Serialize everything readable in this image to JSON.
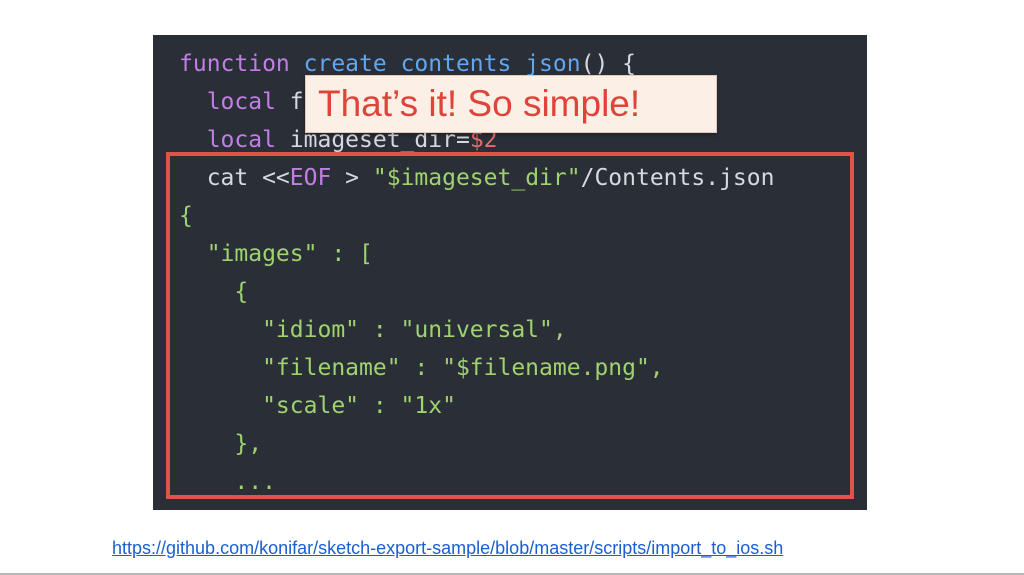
{
  "slide": {
    "callout_text": "That’s it! So simple!",
    "source_link": "https://github.com/konifar/sketch-export-sample/blob/master/scripts/import_to_ios.sh"
  },
  "colors": {
    "background": "#2a2e37",
    "keyword": "#c27ee6",
    "function_name": "#62a6f0",
    "string": "#9fd270",
    "variable": "#e06c6c",
    "highlight_border": "#e0534a",
    "callout_text": "#e0433a",
    "link": "#1a5fd0"
  },
  "code": {
    "lines": [
      [
        {
          "t": "function",
          "k": "kw"
        },
        {
          "t": " ",
          "k": "plain"
        },
        {
          "t": "create_contents_json",
          "k": "fn"
        },
        {
          "t": "() {",
          "k": "plain"
        }
      ],
      [
        {
          "t": "  local",
          "k": "kw"
        },
        {
          "t": " filename=$1",
          "k": "plain"
        }
      ],
      [
        {
          "t": "  local",
          "k": "kw"
        },
        {
          "t": " imageset_dir=",
          "k": "plain"
        },
        {
          "t": "$2",
          "k": "var"
        }
      ],
      [
        {
          "t": "  cat <<",
          "k": "plain"
        },
        {
          "t": "EOF",
          "k": "kw"
        },
        {
          "t": " > ",
          "k": "plain"
        },
        {
          "t": "\"$imageset_dir\"",
          "k": "str"
        },
        {
          "t": "/Contents.json",
          "k": "plain"
        }
      ],
      [
        {
          "t": "{",
          "k": "str"
        }
      ],
      [
        {
          "t": "  \"images\" : [",
          "k": "str"
        }
      ],
      [
        {
          "t": "    {",
          "k": "str"
        }
      ],
      [
        {
          "t": "      \"idiom\" : \"universal\",",
          "k": "str"
        }
      ],
      [
        {
          "t": "      \"filename\" : \"$filename.png\",",
          "k": "str"
        }
      ],
      [
        {
          "t": "      \"scale\" : \"1x\"",
          "k": "str"
        }
      ],
      [
        {
          "t": "    },",
          "k": "str"
        }
      ],
      [
        {
          "t": "    ...",
          "k": "str"
        }
      ]
    ]
  }
}
